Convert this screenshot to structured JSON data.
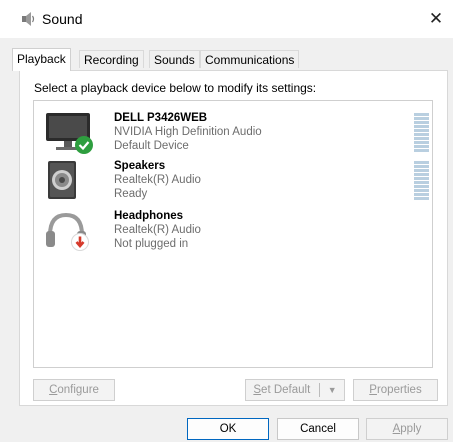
{
  "window": {
    "title": "Sound",
    "close_glyph": "✕"
  },
  "tabs": [
    {
      "label": "Playback",
      "active": true
    },
    {
      "label": "Recording",
      "active": false
    },
    {
      "label": "Sounds",
      "active": false
    },
    {
      "label": "Communications",
      "active": false
    }
  ],
  "instructions": "Select a playback device below to modify its settings:",
  "devices": [
    {
      "name": "DELL P3426WEB",
      "driver": "NVIDIA High Definition Audio",
      "status": "Default Device",
      "icon": "monitor-icon",
      "badge": "default-check-icon"
    },
    {
      "name": "Speakers",
      "driver": "Realtek(R) Audio",
      "status": "Ready",
      "icon": "speaker-icon",
      "badge": ""
    },
    {
      "name": "Headphones",
      "driver": "Realtek(R) Audio",
      "status": "Not plugged in",
      "icon": "headphones-icon",
      "badge": "unplugged-arrow-icon"
    }
  ],
  "buttons": {
    "configure": {
      "hotkey": "C",
      "rest": "onfigure"
    },
    "set_default": {
      "hotkey": "S",
      "rest": "et Default"
    },
    "properties": {
      "hotkey": "P",
      "rest": "roperties"
    },
    "ok": "OK",
    "cancel": "Cancel",
    "apply": {
      "hotkey": "A",
      "rest": "pply"
    }
  },
  "colors": {
    "accent": "#0067c0",
    "check_green": "#2e9e3f",
    "unplugged_red": "#d63a2b",
    "level_meter": "#b9cfe0"
  }
}
